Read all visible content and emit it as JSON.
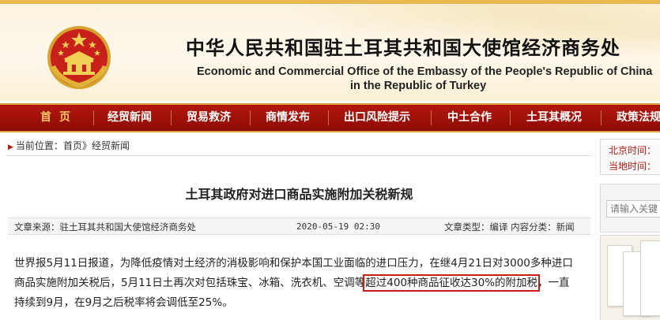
{
  "header": {
    "title_cn": "中华人民共和国驻土耳其共和国大使馆经济商务处",
    "title_en_line1": "Economic and Commercial Office of the Embassy of the People's Republic of China",
    "title_en_line2": "in the Republic of Turkey"
  },
  "nav": {
    "items": [
      {
        "label": "首页"
      },
      {
        "label": "经贸新闻"
      },
      {
        "label": "贸易救济"
      },
      {
        "label": "商情发布"
      },
      {
        "label": "出口风险提示"
      },
      {
        "label": "中土合作"
      },
      {
        "label": "土耳其概况"
      },
      {
        "label": "政策法规"
      }
    ]
  },
  "breadcrumb": {
    "prefix": "当前位置：",
    "home": "首页",
    "sep": "》",
    "current": "经贸新闻"
  },
  "article": {
    "title": "土耳其政府对进口商品实施附加关税新规",
    "meta": {
      "source": "文章来源：驻土耳其共和国大使馆经济商务处",
      "date": "2020-05-19 02:30",
      "type_prefix": "文章类型：",
      "type_translate": "编译",
      "type_category_prefix": "内容分类：",
      "type_category": "新闻"
    },
    "body": {
      "line1": "世界报5月11日报道，为降低疫情对土经济的消极影响和保护本国工业面临的进口压力，在继4月21日对3000多种进口",
      "line2_a": "商品实施附加关税后，5月11日土再次对包括珠宝、冰箱、洗衣机、空调等",
      "line2_highlight": "超过400种商品征收达30%的附加税",
      "line2_b": "，一直",
      "line3": "持续到9月，在9月之后税率将会调低至25%。"
    }
  },
  "sidebar": {
    "beijing_time_label": "北京时间：",
    "local_time_label": "当地时间：",
    "search_placeholder": "请输入关键"
  },
  "colors": {
    "nav_bg": "#a01209",
    "nav_border": "#d8a23c",
    "header_top_stripe": "#e9b84e",
    "highlight_border": "#c81e16",
    "time_label": "#b31a10"
  }
}
